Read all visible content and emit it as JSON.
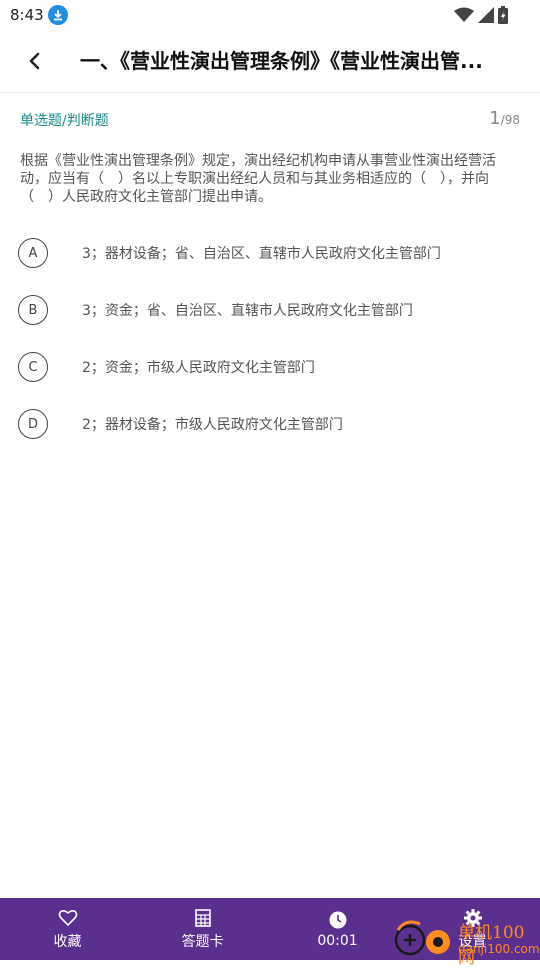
{
  "status_bar": {
    "time": "8:43",
    "icons": [
      "download-icon",
      "wifi-icon",
      "signal-icon",
      "battery-icon"
    ]
  },
  "header": {
    "title": "一、《营业性演出管理条例》《营业性演出管..."
  },
  "question": {
    "type": "单选题/判断题",
    "current": "1",
    "total": "/98",
    "text": "根据《营业性演出管理条例》规定，演出经纪机构申请从事营业性演出经营活动，应当有（　）名以上专职演出经纪人员和与其业务相适应的（　），并向（　）人民政府文化主管部门提出申请。"
  },
  "options": [
    {
      "letter": "A",
      "text": "3；器材设备；省、自治区、直辖市人民政府文化主管部门"
    },
    {
      "letter": "B",
      "text": "3；资金；省、自治区、直辖市人民政府文化主管部门"
    },
    {
      "letter": "C",
      "text": "2；资金；市级人民政府文化主管部门"
    },
    {
      "letter": "D",
      "text": "2；器材设备；市级人民政府文化主管部门"
    }
  ],
  "bottom_nav": {
    "favorite": "收藏",
    "answer_card": "答题卡",
    "timer": "00:01",
    "settings": "设置"
  },
  "watermark": {
    "line1": "单机100网",
    "line2": "danji100.com"
  },
  "colors": {
    "accent_teal": "#1a8a8a",
    "bottom_bar": "#5a2f8e",
    "download_badge": "#1e8fe1",
    "watermark_orange": "#ff8a1e"
  }
}
